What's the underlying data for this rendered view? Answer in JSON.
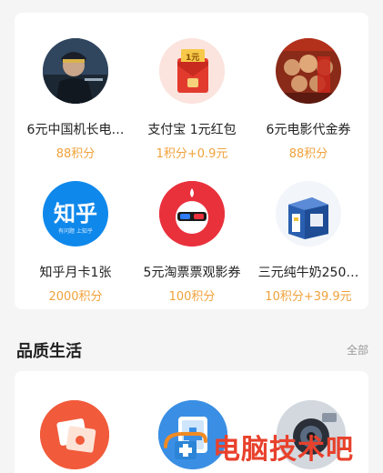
{
  "rewards": [
    {
      "name": "6元中国机长电…",
      "price": "88积分",
      "icon": "film-poster-icon"
    },
    {
      "name": "支付宝 1元红包",
      "price": "1积分+0.9元",
      "icon": "red-envelope-icon"
    },
    {
      "name": "6元电影代金券",
      "price": "88积分",
      "icon": "movie-poster-icon"
    },
    {
      "name": "知乎月卡1张",
      "price": "2000积分",
      "icon": "zhihu-logo-icon",
      "logo_text": "知乎",
      "logo_subtext": "有问题 上知乎"
    },
    {
      "name": "5元淘票票观影券",
      "price": "100积分",
      "icon": "taopiaopiao-logo-icon"
    },
    {
      "name": "三元纯牛奶250…",
      "price": "10积分+39.9元",
      "icon": "milk-box-icon"
    }
  ],
  "red_envelope_label": "1元",
  "section": {
    "title": "品质生活",
    "more": "全部"
  },
  "quality_icons": [
    "photo-frame-icon",
    "medical-kit-icon",
    "camera-lens-icon"
  ],
  "watermark": {
    "text": "电脑技术吧"
  },
  "colors": {
    "price": "#f0a23b",
    "accent_red": "#e8412c",
    "zhihu_blue": "#0f88eb"
  }
}
